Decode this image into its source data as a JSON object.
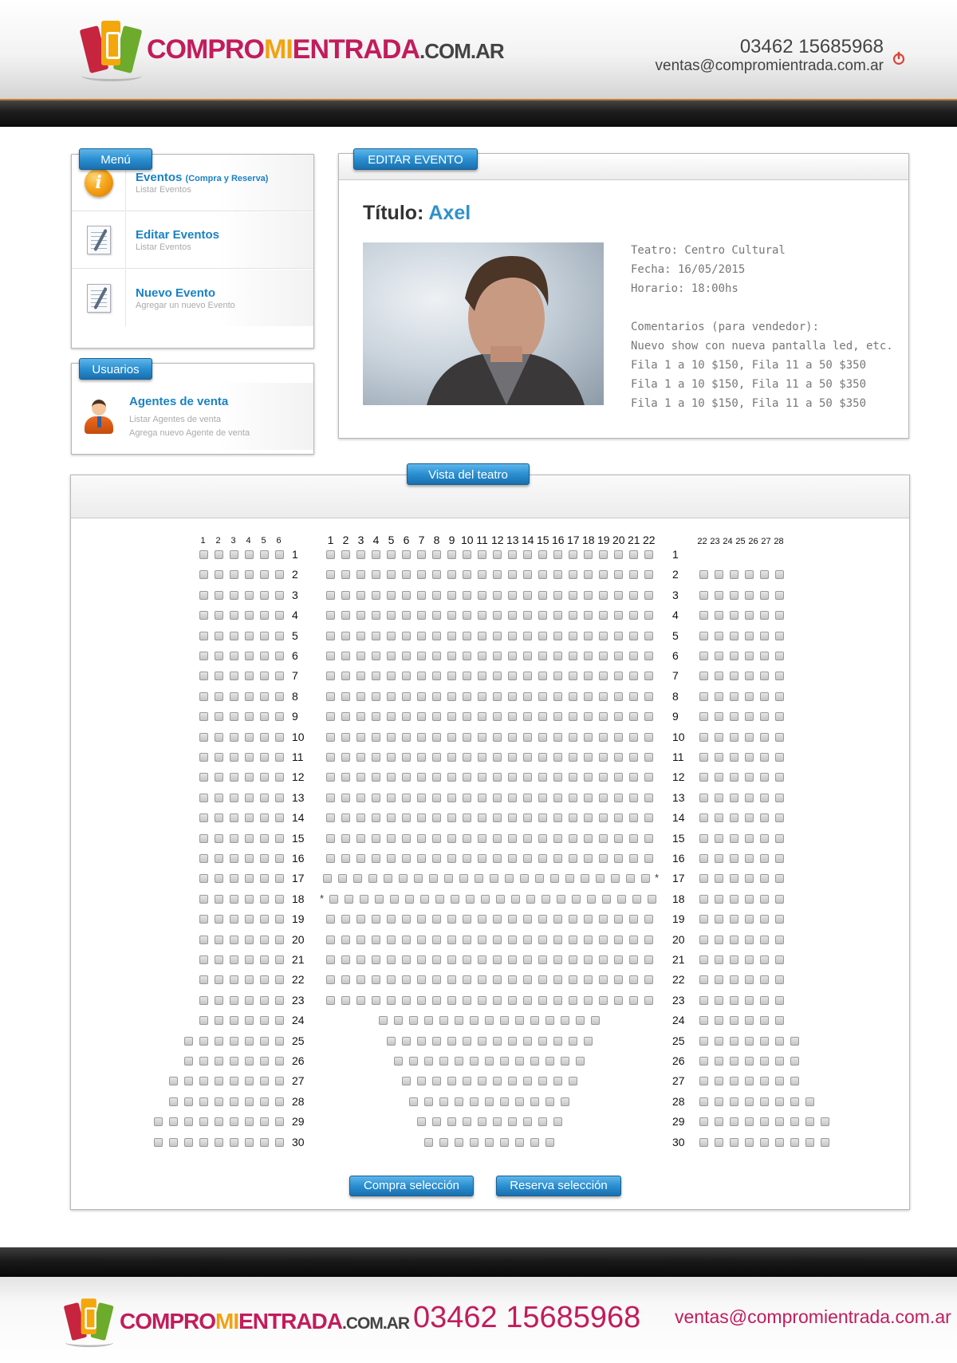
{
  "brand": {
    "part1": "COMPRO",
    "part2": "MI",
    "part3": "ENTRADA",
    "part4": ".COM.AR"
  },
  "header": {
    "phone": "03462 15685968",
    "email": "ventas@compromientrada.com.ar",
    "power_icon": "power-icon"
  },
  "menu": {
    "tab": "Menú",
    "items": [
      {
        "title": "Eventos",
        "title_extra": "(Compra y Reserva)",
        "subtitle": "Listar Eventos",
        "icon": "info-icon"
      },
      {
        "title": "Editar Eventos",
        "title_extra": "",
        "subtitle": "Listar Eventos",
        "icon": "edit-document-icon"
      },
      {
        "title": "Nuevo Evento",
        "title_extra": "",
        "subtitle": "Agregar un nuevo Evento",
        "icon": "new-document-icon"
      }
    ]
  },
  "users": {
    "tab": "Usuarios",
    "item": {
      "title": "Agentes de venta",
      "sub1": "Listar Agentes de venta",
      "sub2": "Agrega nuevo Agente de venta",
      "icon": "user-agent-icon"
    }
  },
  "event": {
    "tab": "EDITAR EVENTO",
    "title_label": "Título:",
    "title_value": "Axel",
    "photo_icon": "artist-photo",
    "info_lines": [
      "Teatro: Centro Cultural",
      "Fecha: 16/05/2015",
      "Horario: 18:00hs",
      "",
      "Comentarios (para vendedor):",
      "Nuevo show con nueva pantalla led, etc.",
      "Fila 1 a 10 $150, Fila 11 a 50 $350",
      "Fila 1 a 10 $150, Fila 11 a 50 $350",
      "Fila 1 a 10 $150, Fila 11 a 50 $350"
    ]
  },
  "theatre": {
    "tab": "Vista del teatro",
    "left_columns": [
      "1",
      "2",
      "3",
      "4",
      "5",
      "6"
    ],
    "center_columns": [
      "1",
      "2",
      "3",
      "4",
      "5",
      "6",
      "7",
      "8",
      "9",
      "10",
      "11",
      "12",
      "13",
      "14",
      "15",
      "16",
      "17",
      "18",
      "19",
      "20",
      "21",
      "22"
    ],
    "right_columns": [
      "22",
      "23",
      "24",
      "25",
      "26",
      "27",
      "28"
    ],
    "rows": [
      "1",
      "2",
      "3",
      "4",
      "5",
      "6",
      "7",
      "8",
      "9",
      "10",
      "11",
      "12",
      "13",
      "14",
      "15",
      "16",
      "17",
      "18",
      "19",
      "20",
      "21",
      "22",
      "23",
      "24",
      "25",
      "26",
      "27",
      "28",
      "29",
      "30"
    ],
    "row_star_right": "17",
    "row_star_left": "18",
    "star_symbol": "*",
    "seat_colors": {
      "available": "#d6d6d6",
      "border": "#9a9a9a"
    },
    "buy_button": "Compra selección",
    "reserve_button": "Reserva selección"
  },
  "footer": {
    "phone": "03462 15685968",
    "email": "ventas@compromientrada.com.ar"
  },
  "colors": {
    "brand_pink": "#c21c5c",
    "brand_orange": "#f0a313",
    "accent_blue": "#2a8fd1",
    "link_blue": "#1a82c4"
  }
}
